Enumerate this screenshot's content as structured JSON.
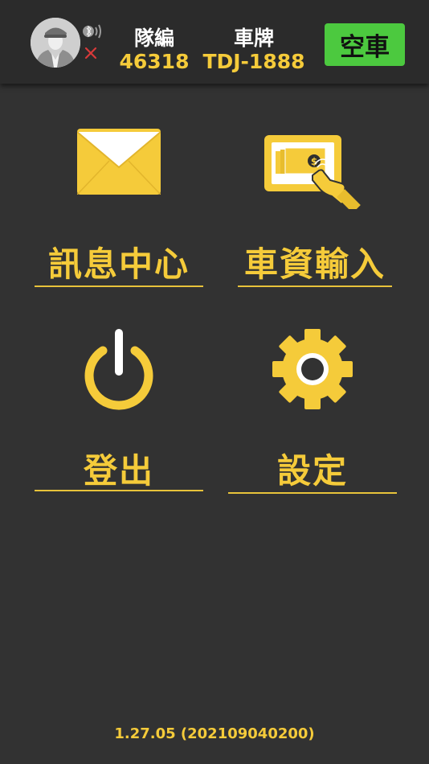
{
  "header": {
    "avatar_icon": "driver-avatar",
    "bluetooth_icon": "bluetooth-icon",
    "disconnected_icon": "close-icon",
    "team_label": "隊編",
    "team_value": "46318",
    "plate_label": "車牌",
    "plate_value": "TDJ-1888",
    "status_button": "空車"
  },
  "menu": {
    "message_center": "訊息中心",
    "car_info_input": "車資輸入",
    "logout": "登出",
    "settings": "設定"
  },
  "version": "1.27.05 (202109040200)",
  "colors": {
    "background": "#323232",
    "header": "#2b2b2b",
    "accent": "#f5cb3a",
    "status_green": "#4cc93f",
    "alert_red": "#d83a3a"
  }
}
